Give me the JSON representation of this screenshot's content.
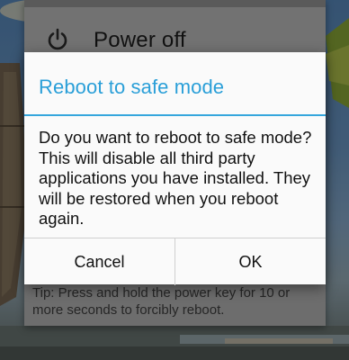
{
  "power_menu": {
    "power_off_label": "Power off",
    "power_icon": "power-icon",
    "tip": "Tip: Press and hold the power key for 10 or more seconds to forcibly reboot."
  },
  "dialog": {
    "title": "Reboot to safe mode",
    "message": "Do you want to reboot to safe mode? This will disable all third party applications you have installed. They will be restored when you reboot again.",
    "cancel_label": "Cancel",
    "ok_label": "OK"
  },
  "colors": {
    "accent": "#2a9fd8",
    "dialog_bg": "#fafafa",
    "menu_bg": "#6d6d6d"
  }
}
